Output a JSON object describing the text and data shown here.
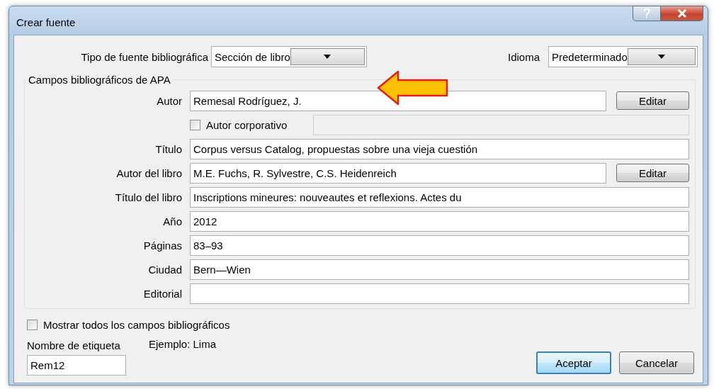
{
  "window": {
    "title": "Crear fuente"
  },
  "source_type": {
    "label": "Tipo de fuente bibliográfica",
    "value": "Sección de libro"
  },
  "language": {
    "label": "Idioma",
    "value": "Predeterminado"
  },
  "fields_group": {
    "title": "Campos bibliográficos de APA",
    "fields": [
      {
        "kind": "text_button",
        "label": "Autor",
        "value": "Remesal Rodríguez, J.",
        "button": "Editar"
      },
      {
        "kind": "checkbox_field",
        "label": "Autor corporativo",
        "checked": false,
        "disabled": true
      },
      {
        "kind": "text",
        "label": "Título",
        "value": "Corpus versus Catalog, propuestas sobre una vieja cuestión"
      },
      {
        "kind": "text_button",
        "label": "Autor del libro",
        "value": "M.E. Fuchs, R. Sylvestre, C.S. Heidenreich",
        "button": "Editar"
      },
      {
        "kind": "text",
        "label": "Título del libro",
        "value": "Inscriptions mineures: nouveautes et reflexions. Actes du"
      },
      {
        "kind": "text",
        "label": "Año",
        "value": "2012"
      },
      {
        "kind": "text",
        "label": "Páginas",
        "value": "83–93"
      },
      {
        "kind": "text",
        "label": "Ciudad",
        "value": "Bern—Wien"
      },
      {
        "kind": "text",
        "label": "Editorial"
      }
    ]
  },
  "show_all": {
    "label": "Mostrar todos los campos bibliográficos",
    "checked": false
  },
  "tag": {
    "label": "Nombre de etiqueta",
    "example": "Ejemplo: Lima",
    "value": "Rem12"
  },
  "buttons": [
    {
      "label": "Aceptar",
      "default": true
    },
    {
      "label": "Cancelar",
      "default": false
    }
  ]
}
